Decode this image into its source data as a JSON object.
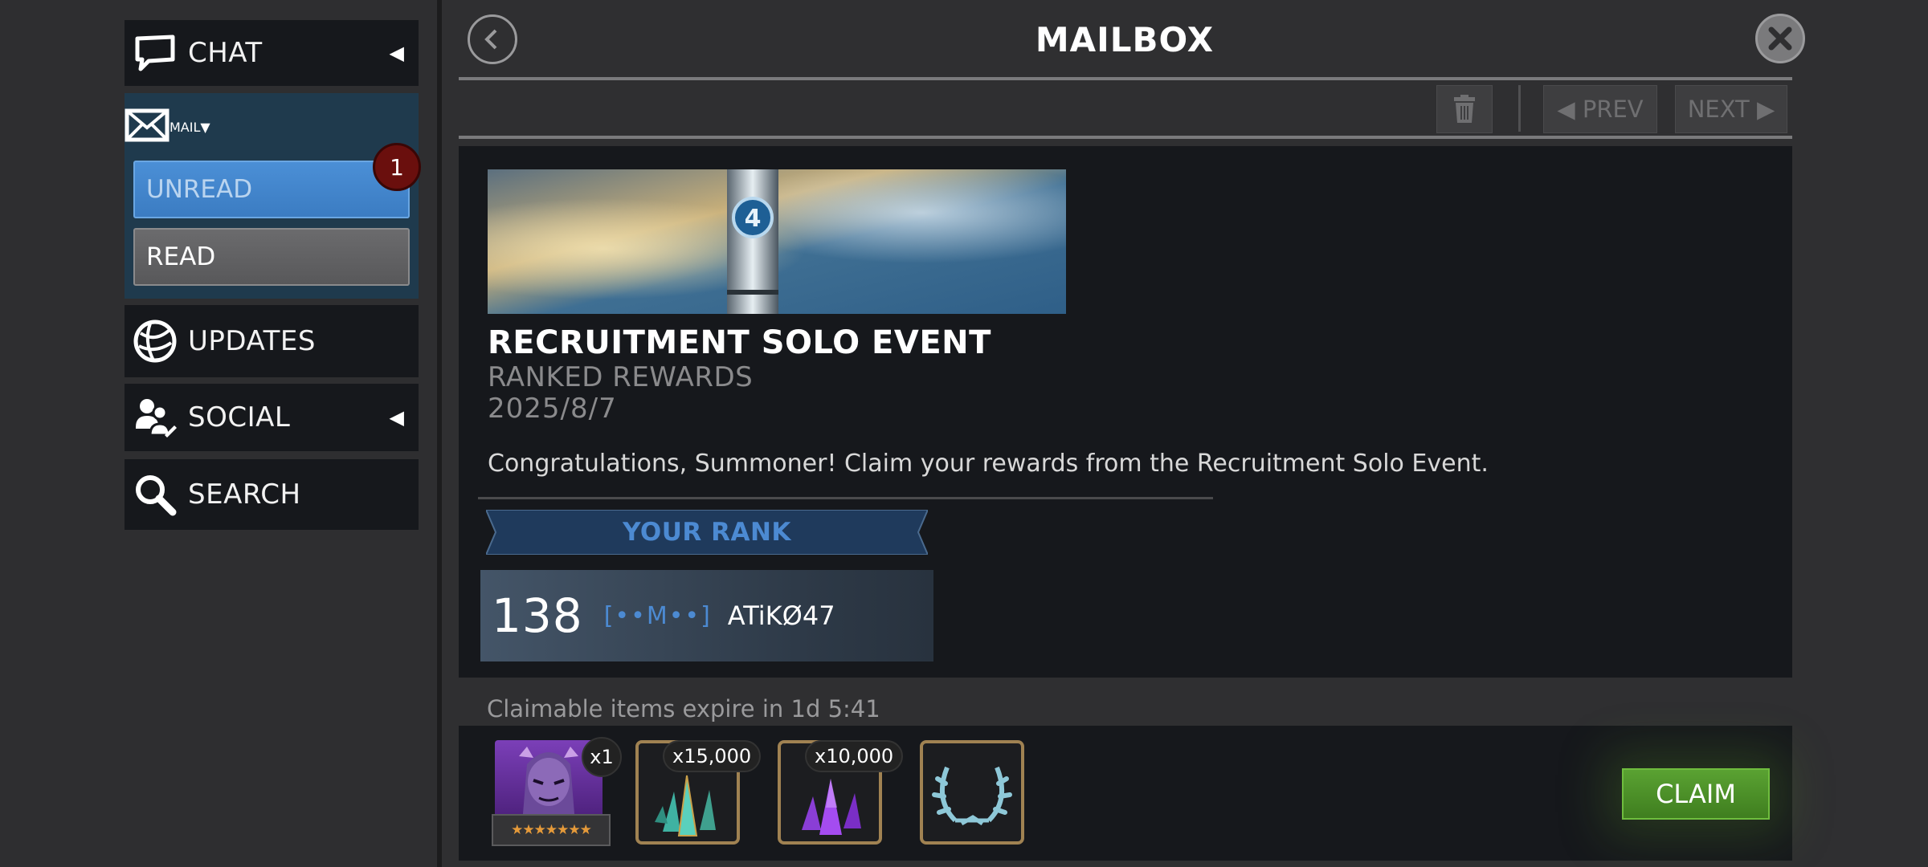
{
  "sidebar": {
    "chat": {
      "label": "CHAT",
      "icon": "chat-icon"
    },
    "mail": {
      "label": "MAIL",
      "icon": "mail-icon",
      "unread_label": "UNREAD",
      "unread_badge": "1",
      "read_label": "READ"
    },
    "updates": {
      "label": "UPDATES",
      "icon": "globe-icon"
    },
    "social": {
      "label": "SOCIAL",
      "icon": "people-icon"
    },
    "search": {
      "label": "SEARCH",
      "icon": "search-icon"
    }
  },
  "header": {
    "title": "MAILBOX",
    "prev_label": "◀ PREV",
    "next_label": "NEXT ▶"
  },
  "message": {
    "title": "RECRUITMENT SOLO EVENT",
    "subtitle": "RANKED REWARDS",
    "date": "2025/8/7",
    "body": "Congratulations, Summoner! Claim your rewards from the Recruitment Solo Event.",
    "rank_header": "YOUR RANK",
    "rank_number": "138",
    "alliance_tag": "[••M••]",
    "player_name": "ATiKØ47"
  },
  "rewards": {
    "expire_text": "Claimable items expire in 1d 5:41",
    "items": [
      {
        "qty": "x1",
        "stars": "★★★★★★★",
        "icon": "champion-portrait-icon"
      },
      {
        "qty": "x15,000",
        "icon": "teal-shards-icon"
      },
      {
        "qty": "x10,000",
        "icon": "purple-crystals-icon"
      },
      {
        "icon": "laurel-wreath-icon"
      }
    ],
    "claim_label": "CLAIM"
  },
  "colors": {
    "accent_blue": "#3b7cc2",
    "claim_green": "#4a9028",
    "badge_red": "#6a0f0d",
    "rank_blue": "#4c8ad2",
    "panel_dark": "#16181c"
  }
}
